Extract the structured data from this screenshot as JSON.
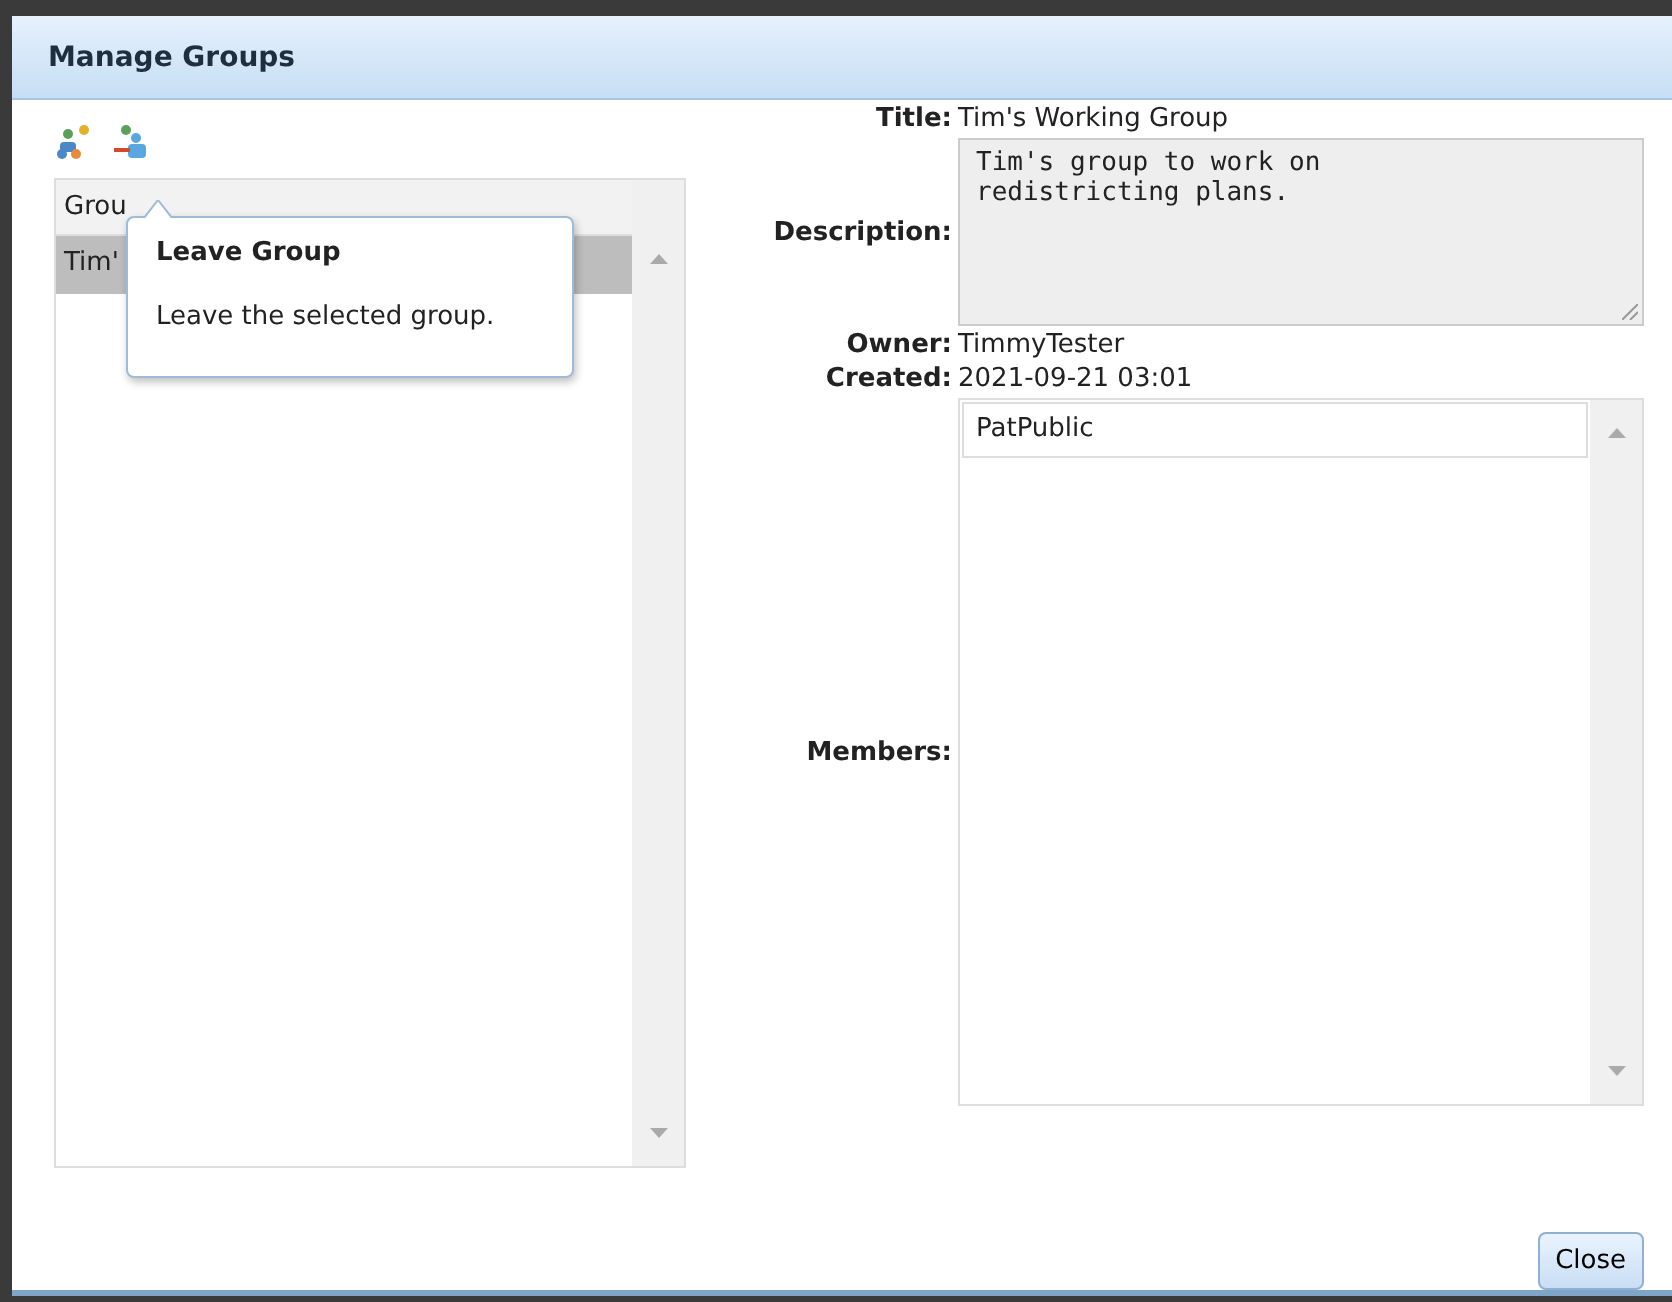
{
  "dialog": {
    "title": "Manage Groups"
  },
  "toolbar": [
    {
      "kind": "manage"
    },
    {
      "kind": "leave"
    }
  ],
  "tooltip": {
    "title": "Leave Group",
    "text": "Leave the selected group."
  },
  "groups_list": {
    "header": "Grou",
    "rows": [
      {
        "name": "Tim'",
        "selected": true
      }
    ]
  },
  "details": {
    "title_label": "Title:",
    "title": "Tim's Working Group",
    "description_label": "Description:",
    "description": "Tim's group to work on\nredistricting plans.",
    "owner_label": "Owner:",
    "owner": "TimmyTester",
    "created_label": "Created:",
    "created": "2021-09-21 03:01",
    "members_label": "Members:",
    "members": [
      "PatPublic"
    ]
  },
  "buttons": [
    "Close"
  ]
}
